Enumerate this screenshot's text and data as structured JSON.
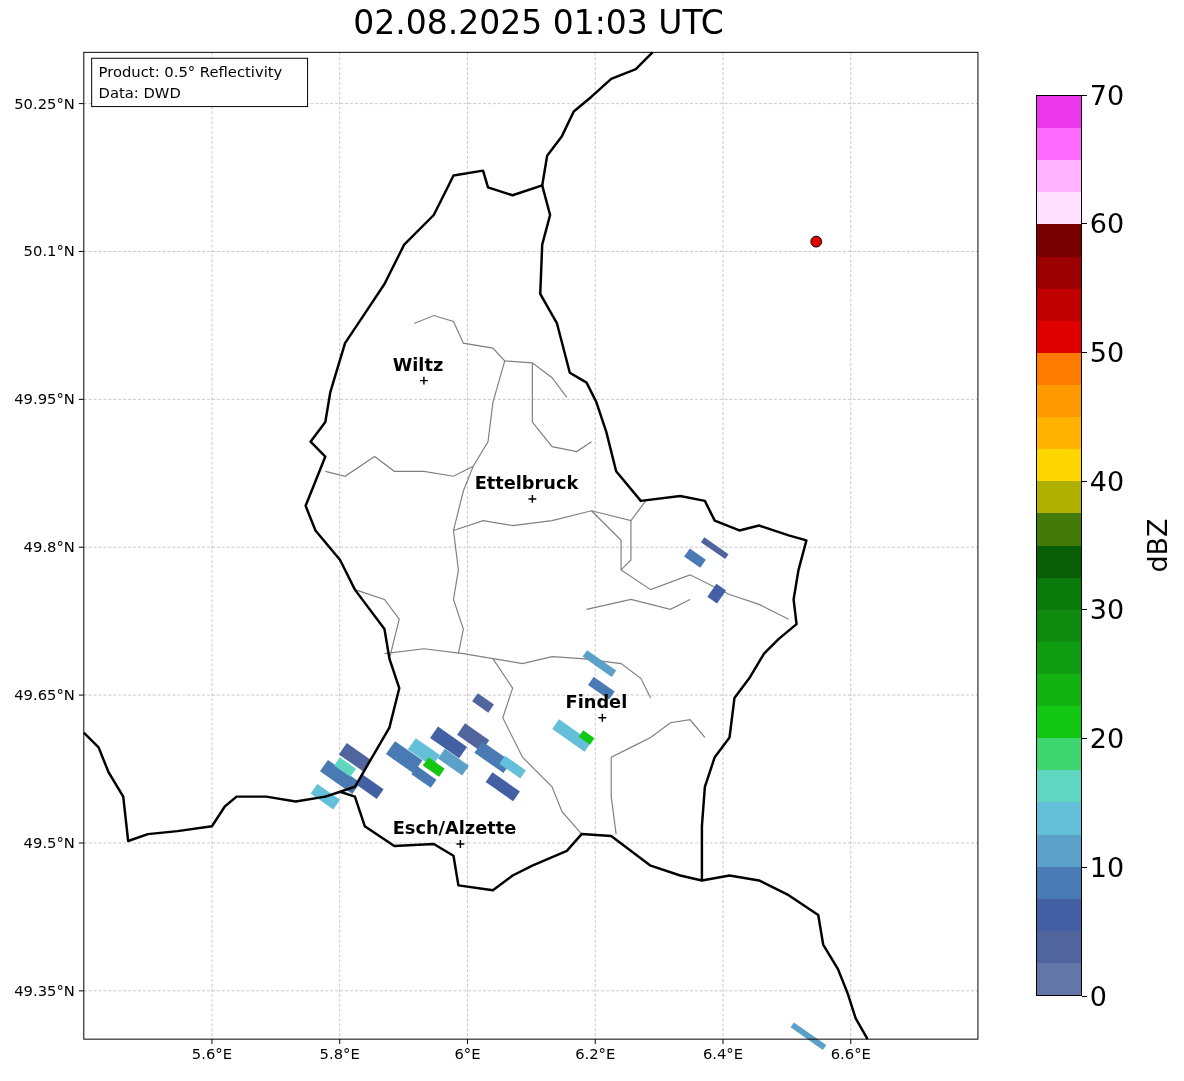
{
  "title": "02.08.2025 01:03 UTC",
  "info_box": {
    "lines": [
      "Product: 0.5° Reflectivity",
      "Data: DWD"
    ]
  },
  "map": {
    "lat_ticks": [
      "50.25°N",
      "50.1°N",
      "49.95°N",
      "49.8°N",
      "49.65°N",
      "49.5°N",
      "49.35°N"
    ],
    "lon_ticks": [
      "5.6°E",
      "5.8°E",
      "6°E",
      "6.2°E",
      "6.4°E",
      "6.6°E"
    ],
    "cities": [
      {
        "name": "Wiltz"
      },
      {
        "name": "Ettelbruck"
      },
      {
        "name": "Findel"
      },
      {
        "name": "Esch/Alzette"
      }
    ]
  },
  "colorbar": {
    "label": "dBZ",
    "ticks": [
      "70",
      "60",
      "50",
      "40",
      "30",
      "20",
      "10",
      "0"
    ],
    "segments": [
      {
        "color": "#ec36ec"
      },
      {
        "color": "#ff6aff"
      },
      {
        "color": "#ffb3ff"
      },
      {
        "color": "#ffe0ff"
      },
      {
        "color": "#780000"
      },
      {
        "color": "#9c0000"
      },
      {
        "color": "#c00000"
      },
      {
        "color": "#e00000"
      },
      {
        "color": "#ff7a00"
      },
      {
        "color": "#ff9900"
      },
      {
        "color": "#ffb300"
      },
      {
        "color": "#ffd700"
      },
      {
        "color": "#b0b000"
      },
      {
        "color": "#437a0a"
      },
      {
        "color": "#075e07"
      },
      {
        "color": "#0a7a0a"
      },
      {
        "color": "#0e8a0e"
      },
      {
        "color": "#109c10"
      },
      {
        "color": "#12b212"
      },
      {
        "color": "#12c812"
      },
      {
        "color": "#3ed66e"
      },
      {
        "color": "#5fd6c0"
      },
      {
        "color": "#64c0d8"
      },
      {
        "color": "#5aa0c8"
      },
      {
        "color": "#4a7ab4"
      },
      {
        "color": "#4460a4"
      },
      {
        "color": "#50649e"
      },
      {
        "color": "#6476a8"
      }
    ]
  }
}
